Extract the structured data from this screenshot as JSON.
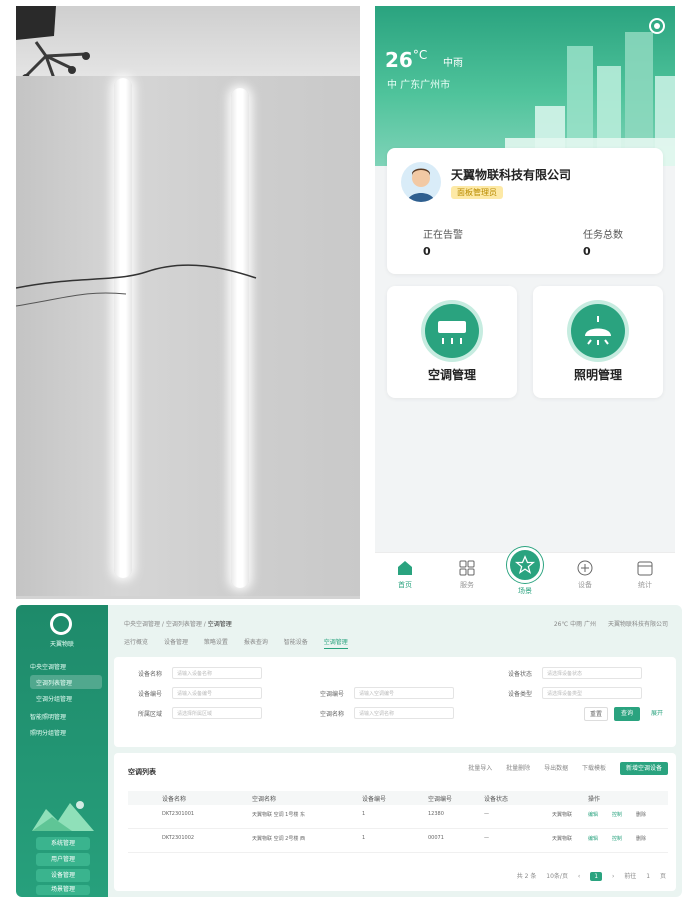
{
  "mobile": {
    "weather": {
      "temperature": "26",
      "unit": "°C",
      "condition": "中雨",
      "location": "中 广东广州市"
    },
    "company": {
      "name": "天翼物联科技有限公司",
      "tag": "面板管理员"
    },
    "stats": [
      {
        "label": "正在告警",
        "value": "0"
      },
      {
        "label": "任务总数",
        "value": "0"
      }
    ],
    "modules": [
      {
        "label": "空调管理"
      },
      {
        "label": "照明管理"
      }
    ],
    "tabbar": [
      {
        "label": "首页"
      },
      {
        "label": "服务"
      },
      {
        "label": "场景"
      },
      {
        "label": "设备"
      },
      {
        "label": "统计"
      }
    ]
  },
  "web": {
    "brand": "天翼物联",
    "sidebar": {
      "items": [
        {
          "label": "中央空调管理"
        },
        {
          "label": "空调列表管理"
        },
        {
          "label": "空调分组管理"
        },
        {
          "label": "智能照明管理"
        },
        {
          "label": "照明分组管理"
        }
      ],
      "buttons": [
        "系统管理",
        "用户管理",
        "设备管理",
        "场景管理"
      ]
    },
    "breadcrumb": {
      "path": "中央空调管理 / 空调列表管理 /",
      "current": "空调管理"
    },
    "subtabs": [
      "运行概览",
      "设备管理",
      "策略设置",
      "报表查询",
      "智能设备",
      "空调管理"
    ],
    "topright": [
      "26℃ 中雨 广州",
      "天翼物联科技有限公司"
    ],
    "filter": {
      "fields": [
        {
          "label": "设备名称",
          "placeholder": "请输入设备名称"
        },
        {
          "label": "设备编号",
          "placeholder": "请输入设备编号"
        },
        {
          "label": "所属区域",
          "placeholder": "请选择所属区域"
        },
        {
          "label": "空调编号",
          "placeholder": "请输入空调编号"
        },
        {
          "label": "设备状态",
          "placeholder": "请选择设备状态"
        },
        {
          "label": "设备类型",
          "placeholder": "请选择设备类型"
        },
        {
          "label": "空调名称",
          "placeholder": "请输入空调名称"
        }
      ],
      "reset": "重置",
      "search": "查询",
      "expand": "展开"
    },
    "table": {
      "title": "空调列表",
      "actions": [
        "批量导入",
        "批量删除",
        "导出数据",
        "下载模板",
        "新增空调设备"
      ],
      "headers": [
        "设备名称",
        "空调名称",
        "设备编号",
        "空调编号",
        "设备状态",
        "操作"
      ],
      "rows": [
        {
          "device": "DKT2301001",
          "name": "天翼物联 空调 1号楼 东",
          "device_no": "1",
          "ac_no": "12380",
          "status": "—",
          "company": "天翼物联",
          "actions": [
            "编辑",
            "控制",
            "删除"
          ]
        },
        {
          "device": "DKT2301002",
          "name": "天翼物联 空调 2号楼 西",
          "device_no": "1",
          "ac_no": "00071",
          "status": "—",
          "company": "天翼物联",
          "actions": [
            "编辑",
            "控制",
            "删除"
          ]
        }
      ]
    },
    "pager": {
      "total": "共 2 条",
      "size": "10条/页",
      "current": "1",
      "goto": "前往",
      "page": "1",
      "unit": "页"
    }
  }
}
